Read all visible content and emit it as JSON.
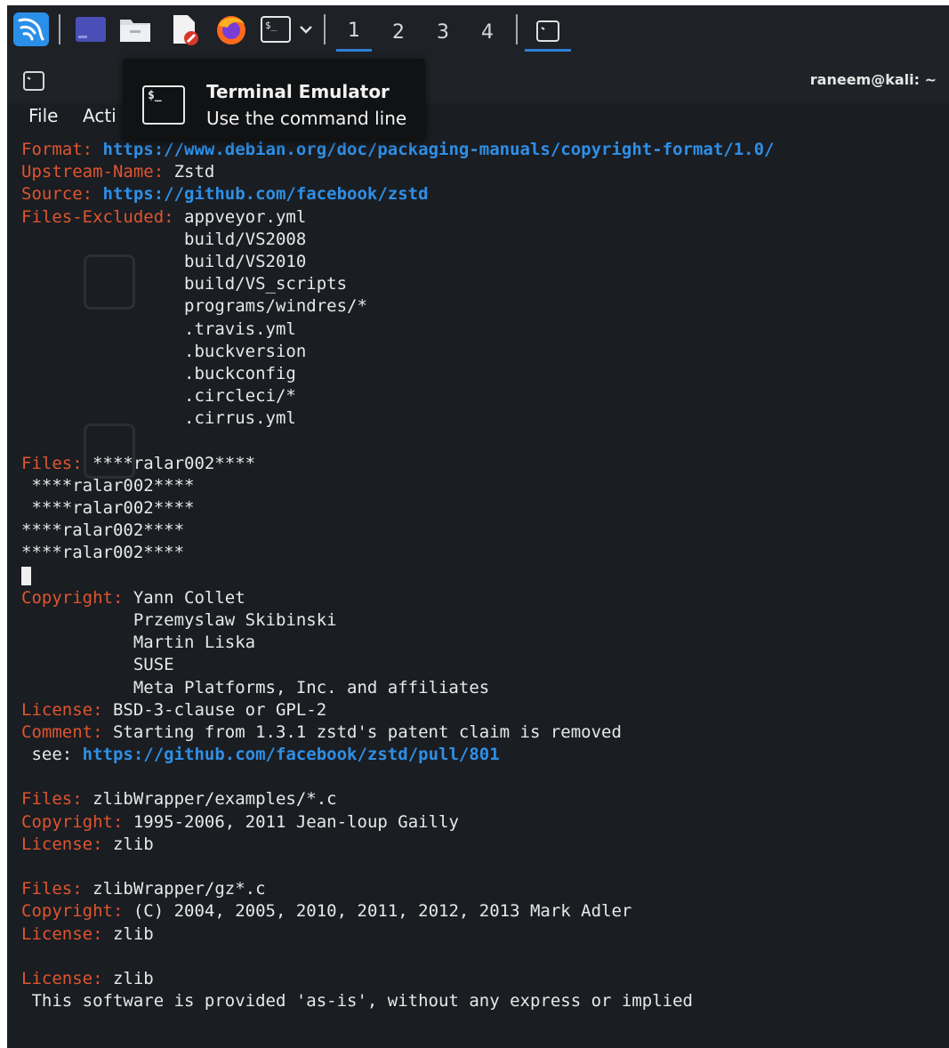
{
  "panel": {
    "apps": [
      {
        "icon": "kali-menu-icon"
      },
      {
        "icon": "desktop-icon"
      },
      {
        "icon": "file-manager-icon"
      },
      {
        "icon": "text-editor-icon"
      },
      {
        "icon": "firefox-icon"
      },
      {
        "icon": "terminal-icon"
      }
    ],
    "workspaces": [
      "1",
      "2",
      "3",
      "4"
    ],
    "active_workspace": "1",
    "colors": {
      "panel_bg": "#1e2126",
      "accent": "#2f7fd6"
    }
  },
  "window": {
    "title": "raneem@kali: ~",
    "menu": [
      "File",
      "Acti"
    ]
  },
  "tooltip": {
    "title": "Terminal Emulator",
    "subtitle": "Use the command line"
  },
  "terminal": {
    "colors": {
      "key": "#e0552e",
      "url": "#2f8fe6",
      "text": "#e8e8e8",
      "bg": "#1a1d22"
    },
    "lines": [
      [
        {
          "t": "Format: ",
          "c": "key"
        },
        {
          "t": "https://www.debian.org/doc/packaging-manuals/copyright-format/1.0/",
          "c": "url"
        }
      ],
      [
        {
          "t": "Upstream-Name: ",
          "c": "key"
        },
        {
          "t": "Zstd"
        }
      ],
      [
        {
          "t": "Source: ",
          "c": "key"
        },
        {
          "t": "https://github.com/facebook/zstd",
          "c": "url"
        }
      ],
      [
        {
          "t": "Files-Excluded: ",
          "c": "key"
        },
        {
          "t": "appveyor.yml"
        }
      ],
      [
        {
          "t": "                build/VS2008"
        }
      ],
      [
        {
          "t": "                build/VS2010"
        }
      ],
      [
        {
          "t": "                build/VS_scripts"
        }
      ],
      [
        {
          "t": "                programs/windres/*"
        }
      ],
      [
        {
          "t": "                .travis.yml"
        }
      ],
      [
        {
          "t": "                .buckversion"
        }
      ],
      [
        {
          "t": "                .buckconfig"
        }
      ],
      [
        {
          "t": "                .circleci/*"
        }
      ],
      [
        {
          "t": "                .cirrus.yml"
        }
      ],
      [
        {
          "t": ""
        }
      ],
      [
        {
          "t": "Files: ",
          "c": "key"
        },
        {
          "t": "****ralar002****"
        }
      ],
      [
        {
          "t": " ****ralar002****"
        }
      ],
      [
        {
          "t": " ****ralar002****"
        }
      ],
      [
        {
          "t": "****ralar002****"
        }
      ],
      [
        {
          "t": "****ralar002****"
        }
      ],
      [
        {
          "t": "",
          "c": "cursor"
        }
      ],
      [
        {
          "t": "Copyright: ",
          "c": "key"
        },
        {
          "t": "Yann Collet"
        }
      ],
      [
        {
          "t": "           Przemyslaw Skibinski"
        }
      ],
      [
        {
          "t": "           Martin Liska"
        }
      ],
      [
        {
          "t": "           SUSE"
        }
      ],
      [
        {
          "t": "           Meta Platforms, Inc. and affiliates"
        }
      ],
      [
        {
          "t": "License: ",
          "c": "key"
        },
        {
          "t": "BSD-3-clause or GPL-2"
        }
      ],
      [
        {
          "t": "Comment: ",
          "c": "key"
        },
        {
          "t": "Starting from 1.3.1 zstd's patent claim is removed"
        }
      ],
      [
        {
          "t": " see: "
        },
        {
          "t": "https://github.com/facebook/zstd/pull/801",
          "c": "url"
        }
      ],
      [
        {
          "t": ""
        }
      ],
      [
        {
          "t": "Files: ",
          "c": "key"
        },
        {
          "t": "zlibWrapper/examples/*.c"
        }
      ],
      [
        {
          "t": "Copyright: ",
          "c": "key"
        },
        {
          "t": "1995-2006, 2011 Jean-loup Gailly"
        }
      ],
      [
        {
          "t": "License: ",
          "c": "key"
        },
        {
          "t": "zlib"
        }
      ],
      [
        {
          "t": ""
        }
      ],
      [
        {
          "t": "Files: ",
          "c": "key"
        },
        {
          "t": "zlibWrapper/gz*.c"
        }
      ],
      [
        {
          "t": "Copyright: ",
          "c": "key"
        },
        {
          "t": "(C) 2004, 2005, 2010, 2011, 2012, 2013 Mark Adler"
        }
      ],
      [
        {
          "t": "License: ",
          "c": "key"
        },
        {
          "t": "zlib"
        }
      ],
      [
        {
          "t": ""
        }
      ],
      [
        {
          "t": "License: ",
          "c": "key"
        },
        {
          "t": "zlib"
        }
      ],
      [
        {
          "t": " This software is provided 'as-is', without any express or implied"
        }
      ]
    ]
  }
}
